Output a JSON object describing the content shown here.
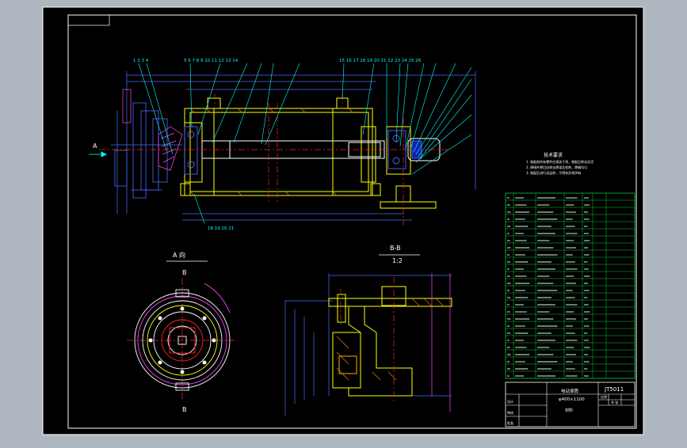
{
  "drawing": {
    "callouts_left": [
      "1",
      "2",
      "3",
      "4"
    ],
    "callouts_mid": [
      "5",
      "6",
      "7",
      "8",
      "9",
      "10",
      "11",
      "12",
      "13",
      "14"
    ],
    "callouts_right": [
      "15",
      "16",
      "17",
      "18",
      "19",
      "20",
      "21",
      "22",
      "23",
      "24",
      "25",
      "26"
    ],
    "callout_bottom": "18 19 20 21",
    "view_arrow": "A",
    "view_a_title": "A 向",
    "view_b_label": "B",
    "section_title": "B-B",
    "section_scale": "1:2",
    "notes_title": "技术要求",
    "notes": [
      "1. 装配前所有零件应清洗干净，装配后转动灵活",
      "2. 焊接件焊后应除去焊渣及毛刺，焊缝均匀",
      "3. 装配后进行试运转，不得有异常声响"
    ]
  },
  "title_block": {
    "drawing_no": "JT5011",
    "name_line1": "电动滚筒",
    "name_line2": "φ400×1100",
    "scale_label": "比例",
    "sheet_label": "共 张",
    "material_label": "材料",
    "designer_label": "设计",
    "checker_label": "审核",
    "approver_label": "批准",
    "parts_rows": 26
  },
  "colors": {
    "background": "#000000",
    "frame": "#ffffff",
    "table": "#00cc33",
    "outline": "#ffff00",
    "hatch": "#ff44ff",
    "dimension": "#4b6bff",
    "center": "#ff2222",
    "leader": "#00ffff"
  }
}
